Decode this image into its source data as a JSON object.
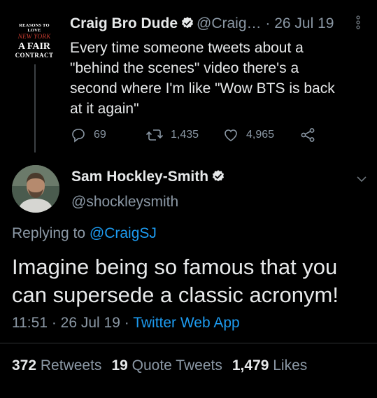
{
  "parent_tweet": {
    "avatar": {
      "line1": "REASONS TO LOVE",
      "line2": "NEW YORK",
      "line3": "A FAIR",
      "line4": "CONTRACT"
    },
    "name": "Craig Bro Dude",
    "handle": "@Craig…",
    "date": "· 26 Jul 19",
    "text": "Every time someone tweets about a\n\"behind the scenes\" video there's a\nsecond where I'm like \"Wow BTS is back\nat it again\"",
    "actions": {
      "replies": "69",
      "retweets": "1,435",
      "likes": "4,965"
    }
  },
  "main_tweet": {
    "name": "Sam Hockley-Smith",
    "handle": "@shockleysmith",
    "replying_prefix": "Replying to",
    "replying_to": "@CraigSJ",
    "text": "Imagine being so famous that you\ncan supersede a classic acronym!",
    "time": "11:51 · 26 Jul 19 ·",
    "source": "Twitter Web App",
    "stats": {
      "retweets_count": "372",
      "retweets_label": "Retweets",
      "quotes_count": "19",
      "quotes_label": "Quote Tweets",
      "likes_count": "1,479",
      "likes_label": "Likes"
    }
  },
  "colors": {
    "background": "#000000",
    "text_primary": "#e7e9ea",
    "text_secondary": "#8b98a5",
    "link": "#1d9bf0"
  },
  "icons": [
    "verified-badge-icon",
    "more-options-icon",
    "reply-icon",
    "retweet-icon",
    "like-icon",
    "share-icon",
    "chevron-down-icon"
  ]
}
